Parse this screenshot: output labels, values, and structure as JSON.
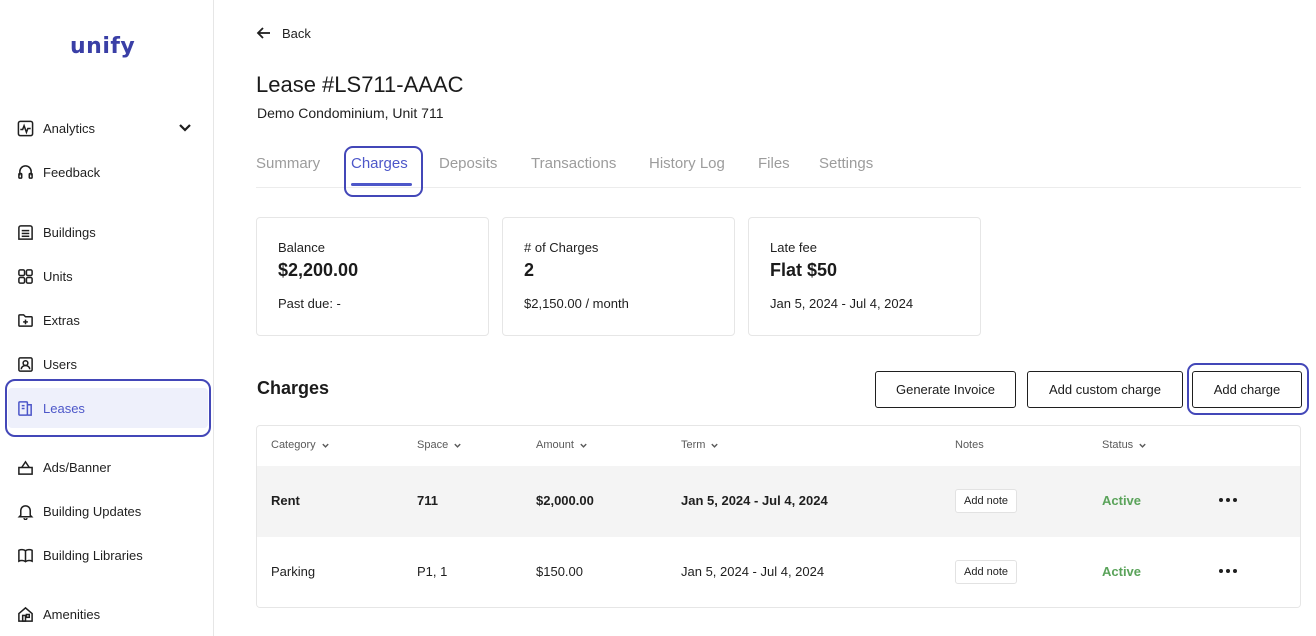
{
  "sidebar": {
    "logo": "unify",
    "items": [
      {
        "label": "Analytics",
        "icon": "analytics-icon"
      },
      {
        "label": "Feedback",
        "icon": "feedback-icon"
      },
      {
        "label": "Buildings",
        "icon": "buildings-icon"
      },
      {
        "label": "Units",
        "icon": "units-icon"
      },
      {
        "label": "Extras",
        "icon": "extras-icon"
      },
      {
        "label": "Users",
        "icon": "users-icon"
      },
      {
        "label": "Leases",
        "icon": "leases-icon"
      },
      {
        "label": "Ads/Banner",
        "icon": "ads-icon"
      },
      {
        "label": "Building Updates",
        "icon": "bell-icon"
      },
      {
        "label": "Building Libraries",
        "icon": "book-icon"
      },
      {
        "label": "Amenities",
        "icon": "amenities-icon"
      }
    ]
  },
  "header": {
    "back_label": "Back",
    "title": "Lease #LS711-AAAC",
    "subtitle": "Demo Condominium, Unit 711"
  },
  "tabs": [
    "Summary",
    "Charges",
    "Deposits",
    "Transactions",
    "History Log",
    "Files",
    "Settings"
  ],
  "active_tab": "Charges",
  "cards": [
    {
      "label": "Balance",
      "value": "$2,200.00",
      "footer": "Past due: -"
    },
    {
      "label": "# of Charges",
      "value": "2",
      "footer": "$2,150.00 / month"
    },
    {
      "label": "Late fee",
      "value": "Flat $50",
      "footer": "Jan 5, 2024 - Jul 4, 2024"
    }
  ],
  "charges": {
    "title": "Charges",
    "buttons": {
      "generate_invoice": "Generate Invoice",
      "add_custom_charge": "Add custom charge",
      "add_charge": "Add charge"
    },
    "columns": [
      "Category",
      "Space",
      "Amount",
      "Term",
      "Notes",
      "Status"
    ],
    "rows": [
      {
        "category": "Rent",
        "space": "711",
        "amount": "$2,000.00",
        "term": "Jan 5, 2024 - Jul 4, 2024",
        "note_label": "Add note",
        "status": "Active"
      },
      {
        "category": "Parking",
        "space": "P1, 1",
        "amount": "$150.00",
        "term": "Jan 5, 2024 - Jul 4, 2024",
        "note_label": "Add note",
        "status": "Active"
      }
    ]
  },
  "colors": {
    "accent": "#4d57c9",
    "highlight_outline": "#4347b8",
    "status_active": "#5aa35a",
    "brand_logo": "#3a3fa6"
  }
}
